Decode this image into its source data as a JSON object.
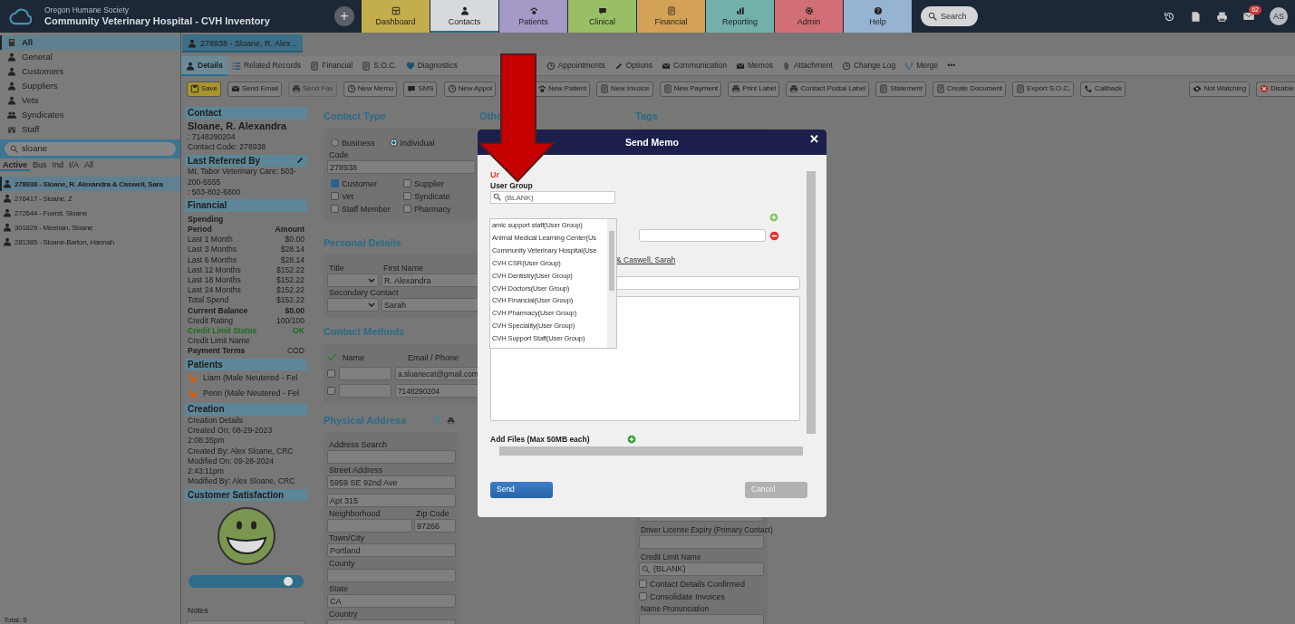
{
  "header": {
    "org": "Oregon Humane Society",
    "title": "Community Veterinary Hospital - CVH Inventory",
    "add_button": "+",
    "nav": [
      {
        "label": "Dashboard",
        "color": "#c4ad4c",
        "selected": false
      },
      {
        "label": "Contacts",
        "color": "#d6dade",
        "selected": true
      },
      {
        "label": "Patients",
        "color": "#a599c8",
        "selected": false
      },
      {
        "label": "Clinical",
        "color": "#98bf66",
        "selected": false
      },
      {
        "label": "Financial",
        "color": "#d3a257",
        "selected": false
      },
      {
        "label": "Reporting",
        "color": "#72b0aa",
        "selected": false
      },
      {
        "label": "Admin",
        "color": "#d26e76",
        "selected": false
      },
      {
        "label": "Help",
        "color": "#97b3d2",
        "selected": false
      }
    ],
    "search": "Search",
    "mail_badge": "62",
    "avatar": "AS"
  },
  "sidebar": {
    "categories": [
      {
        "label": "All",
        "selected": true
      },
      {
        "label": "General",
        "selected": false
      },
      {
        "label": "Customers",
        "selected": false
      },
      {
        "label": "Suppliers",
        "selected": false
      },
      {
        "label": "Vets",
        "selected": false
      },
      {
        "label": "Syndicates",
        "selected": false
      },
      {
        "label": "Staff",
        "selected": false
      }
    ],
    "search": "sloane",
    "filters": [
      {
        "label": "Active",
        "selected": true
      },
      {
        "label": "Bus",
        "selected": false
      },
      {
        "label": "Ind",
        "selected": false
      },
      {
        "label": "I/A",
        "selected": false
      },
      {
        "label": "All",
        "selected": false
      }
    ],
    "results": [
      {
        "label": "278938 - Sloane, R. Alexandra & Caswell, Sara",
        "selected": true
      },
      {
        "label": "276417 - Sloane, Z",
        "selected": false
      },
      {
        "label": "272644 - Fuerst, Sloane",
        "selected": false
      },
      {
        "label": "301829 - Meehan, Sloane",
        "selected": false
      },
      {
        "label": "281385 - Sloane-Barton, Hannah",
        "selected": false
      }
    ],
    "total": "Total: 5"
  },
  "record_tabs": [
    {
      "label": "278938 - Sloane, R. Alex...",
      "selected": true
    }
  ],
  "subtabs": [
    {
      "label": "Details",
      "selected": true
    },
    {
      "label": "Related Records",
      "selected": false
    },
    {
      "label": "Financial",
      "selected": false
    },
    {
      "label": "S.O.C.",
      "selected": false
    },
    {
      "label": "Diagnostics",
      "selected": false
    },
    {
      "label": "Appointments",
      "selected": false
    },
    {
      "label": "Options",
      "selected": false
    },
    {
      "label": "Communication",
      "selected": false
    },
    {
      "label": "Memos",
      "selected": false
    },
    {
      "label": "Attachment",
      "selected": false
    },
    {
      "label": "Change Log",
      "selected": false
    },
    {
      "label": "Merge",
      "selected": false
    },
    {
      "label": "•••",
      "selected": false
    }
  ],
  "toolbar": {
    "left": [
      {
        "label": "Save",
        "kind": "primary",
        "disabled": false
      },
      {
        "label": "Send Email",
        "kind": "plain",
        "disabled": false
      },
      {
        "label": "Send Fax",
        "kind": "plain",
        "disabled": true
      },
      {
        "label": "New Memo",
        "kind": "plain",
        "disabled": false
      },
      {
        "label": "SMS",
        "kind": "plain",
        "disabled": false
      },
      {
        "label": "New Appoi",
        "kind": "plain",
        "disabled": false
      },
      {
        "label": "New Patient",
        "kind": "plain",
        "disabled": false
      },
      {
        "label": "New Invoice",
        "kind": "plain",
        "disabled": false
      },
      {
        "label": "New Payment",
        "kind": "plain",
        "disabled": false
      },
      {
        "label": "Print Label",
        "kind": "plain",
        "disabled": false
      },
      {
        "label": "Contact Postal Label",
        "kind": "plain",
        "disabled": false
      },
      {
        "label": "Statement",
        "kind": "plain",
        "disabled": false
      },
      {
        "label": "Create Document",
        "kind": "plain",
        "disabled": false
      },
      {
        "label": "Export S.O.C.",
        "kind": "plain",
        "disabled": false
      },
      {
        "label": "Callback",
        "kind": "plain",
        "disabled": false
      }
    ],
    "right": [
      {
        "label": "Not Watching",
        "disabled": false
      },
      {
        "label": "Disable",
        "disabled": false
      }
    ]
  },
  "summary": [
    {
      "kind": "header",
      "label": "Contact",
      "editable": false
    },
    {
      "kind": "name",
      "text": "Sloane, R. Alexandra"
    },
    {
      "kind": "text",
      "text": ": 7148290204"
    },
    {
      "kind": "text",
      "text": "Contact Code: 278938"
    },
    {
      "kind": "header",
      "label": "Last Referred By",
      "editable": true
    },
    {
      "kind": "text",
      "text": "Mt. Tabor Veterinary Care: 503-200-5555"
    },
    {
      "kind": "text",
      "text": ": 503-802-6800"
    },
    {
      "kind": "header",
      "label": "Financial",
      "editable": false
    },
    {
      "kind": "subhead",
      "text": "Spending"
    },
    {
      "kind": "pair",
      "label": "Period",
      "value": "Amount",
      "label_bold": true,
      "value_bold": true
    },
    {
      "kind": "pair",
      "label": "Last 1 Month",
      "value": "$0.00",
      "label_bold": false,
      "value_bold": false
    },
    {
      "kind": "pair",
      "label": "Last 3 Months",
      "value": "$28.14",
      "label_bold": false,
      "value_bold": false
    },
    {
      "kind": "pair",
      "label": "Last 6 Months",
      "value": "$28.14",
      "label_bold": false,
      "value_bold": false
    },
    {
      "kind": "pair",
      "label": "Last 12 Months",
      "value": "$152.22",
      "label_bold": false,
      "value_bold": false
    },
    {
      "kind": "pair",
      "label": "Last 18 Months",
      "value": "$152.22",
      "label_bold": false,
      "value_bold": false
    },
    {
      "kind": "pair",
      "label": "Last 24 Months",
      "value": "$152.22",
      "label_bold": false,
      "value_bold": false
    },
    {
      "kind": "pair",
      "label": "Total Spend",
      "value": "$152.22",
      "label_bold": false,
      "value_bold": false
    },
    {
      "kind": "pair",
      "label": "Current Balance",
      "value": "$0.00",
      "label_bold": true,
      "value_bold": true
    },
    {
      "kind": "pair",
      "label": "Credit Rating",
      "value": "100/100",
      "label_bold": false,
      "value_bold": false
    },
    {
      "kind": "status",
      "label": "Credit Limit Status",
      "value": "OK"
    },
    {
      "kind": "text",
      "text": "Credit Limit Name"
    },
    {
      "kind": "pair",
      "label": "Payment Terms",
      "value": "COD",
      "label_bold": true,
      "value_bold": false
    },
    {
      "kind": "header",
      "label": "Patients",
      "editable": false
    },
    {
      "kind": "patient",
      "text": "Liam (Male Neutered - Fel"
    },
    {
      "kind": "patient",
      "text": "Penn (Male Neutered - Fel"
    },
    {
      "kind": "header",
      "label": "Creation",
      "editable": false
    },
    {
      "kind": "text",
      "text": "Creation Details"
    },
    {
      "kind": "text",
      "text": "Created On: 08-29-2023 2:08:35pm"
    },
    {
      "kind": "text",
      "text": "Created By: Alex Sloane, CRC"
    },
    {
      "kind": "text",
      "text": "Modified On: 09-28-2024 2:43:11pm"
    },
    {
      "kind": "text",
      "text": "Modified By: Alex Sloane, CRC"
    },
    {
      "kind": "header",
      "label": "Customer Satisfaction",
      "editable": false
    },
    {
      "kind": "satisfaction",
      "level": 0.92
    },
    {
      "kind": "notes",
      "label": "Notes"
    }
  ],
  "contact_type": {
    "heading": "Contact Type",
    "options": [
      {
        "label": "Business",
        "selected": false
      },
      {
        "label": "Individual",
        "selected": true
      }
    ],
    "code_label": "Code",
    "code": "278938",
    "roles": [
      {
        "label": "Customer",
        "checked": true
      },
      {
        "label": "Supplier",
        "checked": false
      },
      {
        "label": "Vet",
        "checked": false
      },
      {
        "label": "Syndicate",
        "checked": false
      },
      {
        "label": "Staff Member",
        "checked": false
      },
      {
        "label": "Pharmacy",
        "checked": false
      }
    ]
  },
  "personal_details": {
    "heading": "Personal Details",
    "rows": [
      {
        "select_label": "Title",
        "input_label": "First Name",
        "value": "R. Alexandra"
      },
      {
        "select_label": "Secondary Contact",
        "value": "Sarah"
      }
    ]
  },
  "contact_methods": {
    "heading": "Contact Methods",
    "columns": [
      "Name",
      "Email / Phone"
    ],
    "rows": [
      {
        "checked": false,
        "value": "a.sloanecat@gmail.com"
      },
      {
        "checked": false,
        "value": "7148290204"
      }
    ]
  },
  "physical_address": {
    "heading": "Physical Address",
    "fields": [
      {
        "kind": "wide",
        "label": "Address Search"
      },
      {
        "kind": "wide",
        "label": "Street Address",
        "value": "5959 SE 92nd Ave"
      },
      {
        "kind": "wide",
        "value": "Apt 315"
      },
      {
        "kind": "split",
        "label": "Neighborhood",
        "label_2": "Zip Code",
        "value_2": "97266"
      },
      {
        "kind": "wide",
        "label": "Town/City",
        "value": "Portland"
      },
      {
        "kind": "wide",
        "label": "County"
      },
      {
        "kind": "wide",
        "label": "State",
        "value": "CA"
      },
      {
        "kind": "wide",
        "label": "Country"
      }
    ]
  },
  "other": {
    "heading": "Othe"
  },
  "tags": {
    "heading": "Tags",
    "fields": [
      {
        "kind": "input"
      },
      {
        "kind": "input",
        "label": "Driver License Expiry (Primary Contact)"
      },
      {
        "kind": "lookup",
        "label": "Credit Limit Name",
        "placeholder": "(BLANK)"
      },
      {
        "kind": "check",
        "label": "Contact Details Confirmed",
        "checked": false
      },
      {
        "kind": "check",
        "label": "Consolidate Invoices",
        "checked": false
      },
      {
        "kind": "input",
        "label": "Name Pronunciation"
      }
    ]
  },
  "modal": {
    "title": "Send Memo",
    "close": "✕",
    "flag": "Ur",
    "user_group": {
      "label": "User Group",
      "placeholder": "(BLANK)",
      "options": [
        "amic support staff(User Group)",
        "Animal Medical Learning Center(Us",
        "Community Veterinary Hospital(Use",
        "CVH CSR(User Group)",
        "CVH Dentistry(User Group)",
        "CVH Doctors(User Group)",
        "CVH Financial(User Group)",
        "CVH Pharmacy(User Group)",
        "CVH Speciality(User Group)",
        "CVH Support Staff(User Group)"
      ]
    },
    "link": "& Caswell, Sarah",
    "add_files": "Add Files (Max 50MB each)",
    "buttons": [
      {
        "label": "Send",
        "kind": "primary"
      },
      {
        "label": "Cancel",
        "kind": "secondary"
      }
    ]
  }
}
